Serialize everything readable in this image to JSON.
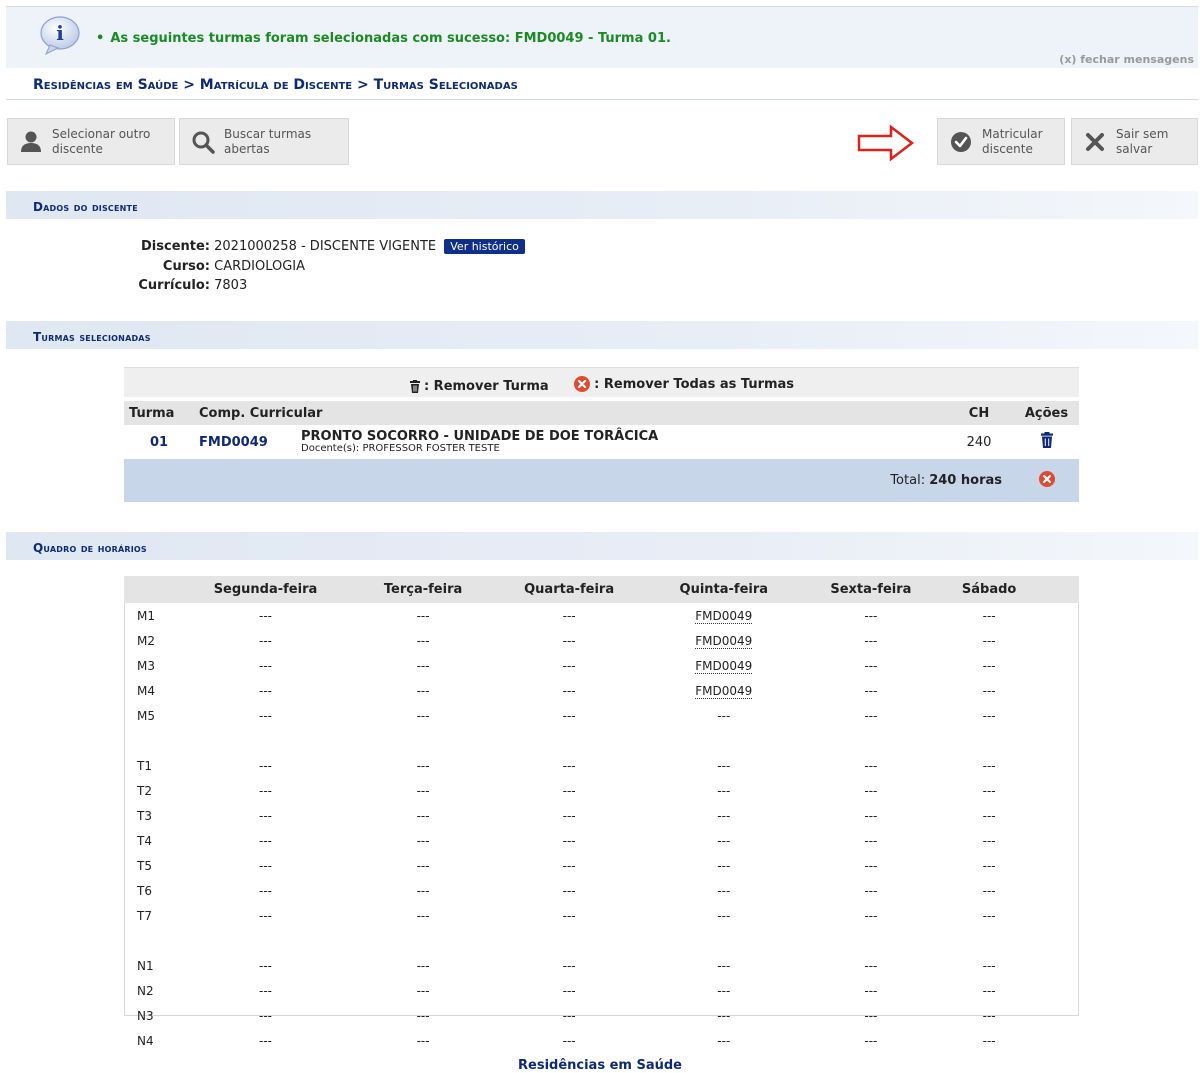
{
  "message": {
    "text": "As seguintes turmas foram selecionadas com sucesso: FMD0049 - Turma 01.",
    "close_label": "(x) fechar mensagens"
  },
  "breadcrumb": "Residências em Saúde > Matrícula de Discente > Turmas Selecionadas",
  "toolbar": {
    "select_other": [
      "Selecionar outro",
      "discente"
    ],
    "search_open": [
      "Buscar turmas",
      "abertas"
    ],
    "enroll": [
      "Matricular",
      "discente"
    ],
    "exit": [
      "Sair sem",
      "salvar"
    ]
  },
  "student_section": {
    "title": "Dados do discente",
    "discente_label": "Discente:",
    "discente_value": "2021000258 - DISCENTE VIGENTE",
    "history_button": "Ver histórico",
    "curso_label": "Curso:",
    "curso_value": "CARDIOLOGIA",
    "curriculo_label": "Currículo:",
    "curriculo_value": "7803"
  },
  "classes_section": {
    "title": "Turmas selecionadas",
    "legend_remove": ": Remover Turma",
    "legend_remove_all": ": Remover Todas as Turmas",
    "columns": [
      "Turma",
      "Comp. Curricular",
      "CH",
      "Ações"
    ],
    "row": {
      "turma": "01",
      "code": "FMD0049",
      "name": "PRONTO SOCORRO - UNIDADE DE DOE TORÂCICA",
      "docentes": "Docente(s): PROFESSOR FOSTER TESTE",
      "ch": "240"
    },
    "total_label": "Total:",
    "total_value": "240 horas"
  },
  "schedule_section": {
    "title": "Quadro de horários",
    "days": [
      "Segunda-feira",
      "Terça-feira",
      "Quarta-feira",
      "Quinta-feira",
      "Sexta-feira",
      "Sábado"
    ],
    "empty": "---",
    "rows": [
      {
        "slot": "M1",
        "cells": [
          "---",
          "---",
          "---",
          "FMD0049",
          "---",
          "---"
        ]
      },
      {
        "slot": "M2",
        "cells": [
          "---",
          "---",
          "---",
          "FMD0049",
          "---",
          "---"
        ]
      },
      {
        "slot": "M3",
        "cells": [
          "---",
          "---",
          "---",
          "FMD0049",
          "---",
          "---"
        ]
      },
      {
        "slot": "M4",
        "cells": [
          "---",
          "---",
          "---",
          "FMD0049",
          "---",
          "---"
        ]
      },
      {
        "slot": "M5",
        "cells": [
          "---",
          "---",
          "---",
          "---",
          "---",
          "---"
        ]
      },
      {
        "slot": "",
        "cells": [
          "",
          "",
          "",
          "",
          "",
          ""
        ]
      },
      {
        "slot": "T1",
        "cells": [
          "---",
          "---",
          "---",
          "---",
          "---",
          "---"
        ]
      },
      {
        "slot": "T2",
        "cells": [
          "---",
          "---",
          "---",
          "---",
          "---",
          "---"
        ]
      },
      {
        "slot": "T3",
        "cells": [
          "---",
          "---",
          "---",
          "---",
          "---",
          "---"
        ]
      },
      {
        "slot": "T4",
        "cells": [
          "---",
          "---",
          "---",
          "---",
          "---",
          "---"
        ]
      },
      {
        "slot": "T5",
        "cells": [
          "---",
          "---",
          "---",
          "---",
          "---",
          "---"
        ]
      },
      {
        "slot": "T6",
        "cells": [
          "---",
          "---",
          "---",
          "---",
          "---",
          "---"
        ]
      },
      {
        "slot": "T7",
        "cells": [
          "---",
          "---",
          "---",
          "---",
          "---",
          "---"
        ]
      },
      {
        "slot": "",
        "cells": [
          "",
          "",
          "",
          "",
          "",
          ""
        ]
      },
      {
        "slot": "N1",
        "cells": [
          "---",
          "---",
          "---",
          "---",
          "---",
          "---"
        ]
      },
      {
        "slot": "N2",
        "cells": [
          "---",
          "---",
          "---",
          "---",
          "---",
          "---"
        ]
      },
      {
        "slot": "N3",
        "cells": [
          "---",
          "---",
          "---",
          "---",
          "---",
          "---"
        ]
      },
      {
        "slot": "N4",
        "cells": [
          "---",
          "---",
          "---",
          "---",
          "---",
          "---"
        ]
      }
    ]
  },
  "footer": "Residências em Saúde",
  "colors": {
    "accent": "#0d2a78",
    "success": "#1c8b22",
    "arrow": "#e0201b"
  },
  "icons": [
    "info-icon",
    "user-icon",
    "search-icon",
    "check-circle-icon",
    "close-x-icon",
    "trash-icon",
    "remove-circle-icon",
    "arrow-right-icon"
  ]
}
